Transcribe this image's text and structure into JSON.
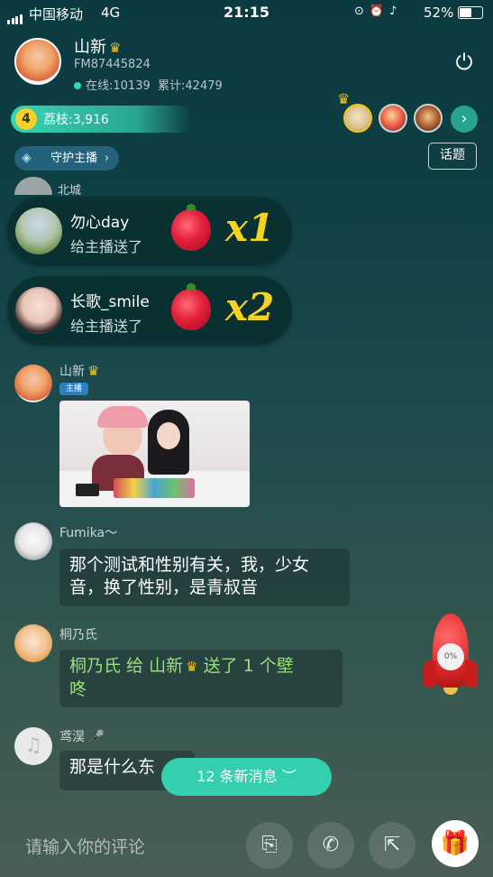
{
  "status_bar": {
    "carrier": "中国移动",
    "network": "4G",
    "time": "21:15",
    "battery": "52%"
  },
  "host": {
    "name": "山新",
    "fm": "FM87445824",
    "online_label": "在线:10139",
    "total_label": "累计:42479"
  },
  "lychee": {
    "level": "4",
    "label": "荔枝:3,916"
  },
  "guard_label": "守护主播",
  "topic_label": "话题",
  "partial_name": "北城",
  "gifts": [
    {
      "user": "勿心day",
      "text": "给主播送了",
      "count": "x1"
    },
    {
      "user": "长歌_smile",
      "text": "给主播送了",
      "count": "x2"
    }
  ],
  "chat": {
    "host_msg": {
      "name": "山新",
      "badge": "主播"
    },
    "msg1": {
      "name": "Fumika～",
      "line1": "那个测试和性别有关，我，少女",
      "line2": "音，换了性别，是青叔音"
    },
    "msg2": {
      "name": "桐乃氏",
      "line1a": "桐乃氏 给 山新",
      "line1b": " 送了 1 个壁",
      "line2": "咚"
    },
    "msg3": {
      "name": "鸢淏",
      "text": "那是什么东"
    }
  },
  "new_messages": "12 条新消息",
  "rocket_progress": "0%",
  "comment_placeholder": "请输入你的评论",
  "colors": {
    "accent": "#33cfae",
    "crown": "#f5c518",
    "gift_count": "#f5d324",
    "gift_text": "#98e07a"
  }
}
